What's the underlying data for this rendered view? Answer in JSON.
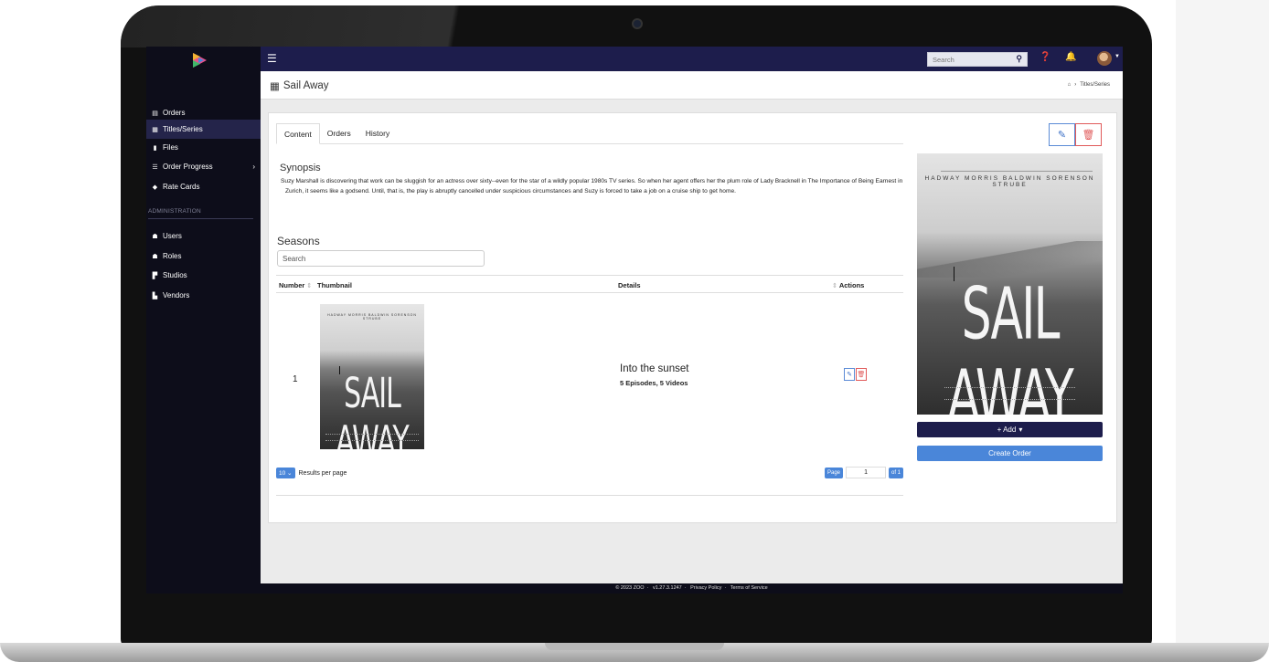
{
  "topbar": {
    "search_placeholder": "Search",
    "icons": [
      "menu-icon",
      "search-icon",
      "help-icon",
      "bell-icon",
      "avatar"
    ]
  },
  "sidebar": {
    "items": [
      {
        "label": "Orders",
        "icon": "orders-icon"
      },
      {
        "label": "Titles/Series",
        "icon": "film-icon",
        "active": true
      },
      {
        "label": "Files",
        "icon": "file-icon"
      },
      {
        "label": "Order Progress",
        "icon": "progress-icon",
        "has_chevron": true
      },
      {
        "label": "Rate Cards",
        "icon": "tag-icon"
      }
    ],
    "section_label": "ADMINISTRATION",
    "admin_items": [
      {
        "label": "Users",
        "icon": "users-icon"
      },
      {
        "label": "Roles",
        "icon": "roles-icon"
      },
      {
        "label": "Studios",
        "icon": "studio-icon"
      },
      {
        "label": "Vendors",
        "icon": "vendor-icon"
      }
    ]
  },
  "header": {
    "title": "Sail Away",
    "breadcrumb": [
      "Titles/Series"
    ]
  },
  "main": {
    "tabs": [
      {
        "label": "Content",
        "active": true
      },
      {
        "label": "Orders"
      },
      {
        "label": "History"
      }
    ],
    "synopsis_title": "Synopsis",
    "synopsis_text": "Suzy Marshall is discovering that work can be sluggish for an actress over sixty--even for the star of a wildly popular 1980s TV series. So when her agent offers her the plum role of Lady Bracknell in The Importance of Being Earnest in Zurich, it seems like a godsend. Until, that is, the play is abruptly cancelled under suspicious circumstances and Suzy is forced to take a job on a cruise ship to get home.",
    "seasons_title": "Seasons",
    "seasons_search_placeholder": "Search",
    "columns": {
      "number": "Number",
      "thumbnail": "Thumbnail",
      "details": "Details",
      "actions": "Actions"
    },
    "rows": [
      {
        "number": "1",
        "details_title": "Into the sunset",
        "details_sub": "5 Episodes, 5 Videos",
        "poster_title": "SAIL AWAY"
      }
    ],
    "per_page_value": "10",
    "per_page_label": "Results per page",
    "pager": {
      "label": "Page",
      "current": "1",
      "of": "of 1"
    },
    "poster_title": "SAIL AWAY",
    "poster_names": "HADWAY   MORRIS   BALDWIN   SORENSON   STRUBE",
    "add_button": "+ Add",
    "create_order_button": "Create Order"
  },
  "footer": {
    "copyright": "© 2023 ZOO",
    "version": "v1.27.3.1247",
    "privacy": "Privacy Policy",
    "terms": "Terms of Service"
  },
  "colors": {
    "topbar": "#1d1d4c",
    "sidebar": "#0d0d1a",
    "accent": "#4a86d9",
    "danger": "#e05a5a"
  }
}
